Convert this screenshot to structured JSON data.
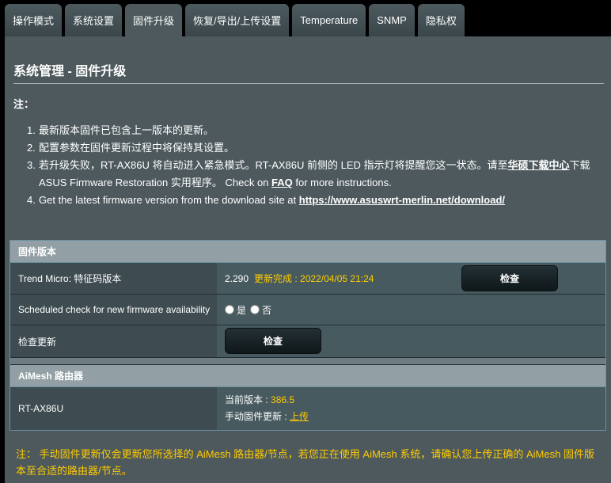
{
  "tabs": [
    {
      "label": "操作模式"
    },
    {
      "label": "系统设置"
    },
    {
      "label": "固件升级"
    },
    {
      "label": "恢复/导出/上传设置"
    },
    {
      "label": "Temperature"
    },
    {
      "label": "SNMP"
    },
    {
      "label": "隐私权"
    }
  ],
  "page": {
    "title": "系统管理 - 固件升级",
    "note_label": "注：",
    "notes": {
      "n1": "最新版本固件已包含上一版本的更新。",
      "n2": "配置参数在固件更新过程中将保持其设置。",
      "n3_a": "若升级失败，RT-AX86U 将自动进入紧急模式。RT-AX86U 前侧的 LED 指示灯将提醒您这一状态。请至",
      "n3_link": "华硕下载中心",
      "n3_b": "下载",
      "n3_c": "ASUS Firmware Restoration 实用程序。 Check on ",
      "n3_faq": "FAQ",
      "n3_d": " for more instructions.",
      "n4_a": "Get the latest firmware version from the download site at ",
      "n4_link": "https://www.asuswrt-merlin.net/download/"
    },
    "nums": [
      "1.",
      "2.",
      "3.",
      "4."
    ]
  },
  "firmware_table": {
    "header": "固件版本",
    "trend_label": "Trend Micro: 特征码版本",
    "trend_version": "2.290",
    "trend_status": "更新完成 : 2022/04/05 21:24",
    "check_button": "检查",
    "scheduled_label": "Scheduled check for new firmware availability",
    "radio_yes": "是",
    "radio_no": "否",
    "check_update_label": "检查更新",
    "check_update_button": "检查"
  },
  "aimesh_table": {
    "header": "AiMesh 路由器",
    "model": "RT-AX86U",
    "current_label": "当前版本 : ",
    "current_version": "386.5",
    "manual_label": "手动固件更新 : ",
    "upload_link": "上传"
  },
  "footer_note": "注： 手动固件更新仅会更新您所选择的 AiMesh 路由器/节点，若您正在使用 AiMesh 系统，请确认您上传正确的 AiMesh 固件版本至合适的路由器/节点。"
}
